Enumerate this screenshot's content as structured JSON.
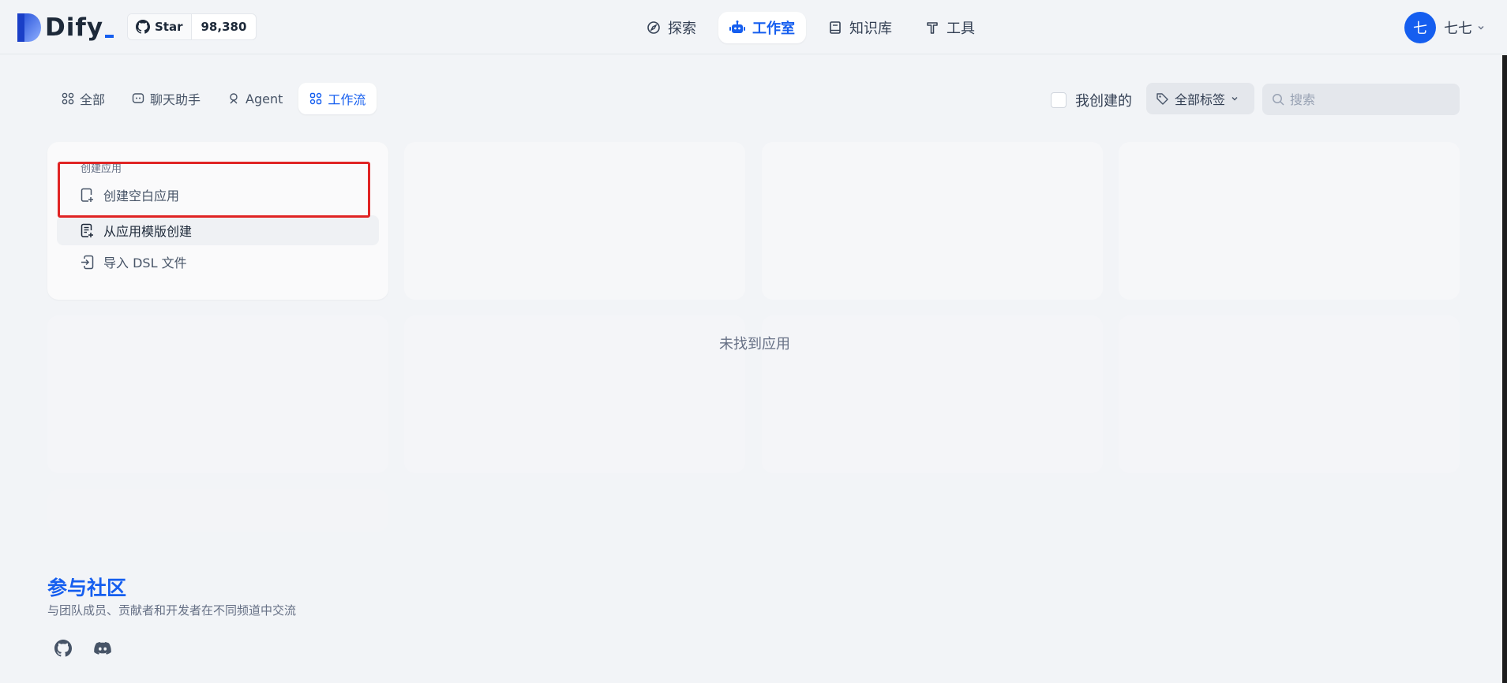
{
  "header": {
    "logo_text": "Dify",
    "star_label": "Star",
    "star_count": "98,380",
    "nav": [
      {
        "label": "探索",
        "icon": "compass-icon",
        "active": false
      },
      {
        "label": "工作室",
        "icon": "robot-icon",
        "active": true
      },
      {
        "label": "知识库",
        "icon": "book-icon",
        "active": false
      },
      {
        "label": "工具",
        "icon": "hammer-icon",
        "active": false
      }
    ],
    "user": {
      "avatar_letter": "七",
      "name": "七七"
    }
  },
  "filters": {
    "tabs": [
      {
        "label": "全部",
        "icon": "grid-icon",
        "active": false
      },
      {
        "label": "聊天助手",
        "icon": "chat-icon",
        "active": false
      },
      {
        "label": "Agent",
        "icon": "agent-icon",
        "active": false
      },
      {
        "label": "工作流",
        "icon": "workflow-icon",
        "active": true
      }
    ],
    "mine_label": "我创建的",
    "tags_label": "全部标签",
    "search_placeholder": "搜索"
  },
  "create": {
    "title": "创建应用",
    "items": [
      {
        "label": "创建空白应用",
        "icon": "blank-file-icon"
      },
      {
        "label": "从应用模版创建",
        "icon": "template-icon"
      },
      {
        "label": "导入 DSL 文件",
        "icon": "import-icon"
      }
    ]
  },
  "empty_text": "未找到应用",
  "community": {
    "title": "参与社区",
    "description": "与团队成员、贡献者和开发者在不同频道中交流",
    "links": [
      "github-icon",
      "discord-icon"
    ]
  },
  "colors": {
    "accent": "#155eef",
    "highlight_border": "#e02424",
    "background": "#f2f4f7"
  }
}
